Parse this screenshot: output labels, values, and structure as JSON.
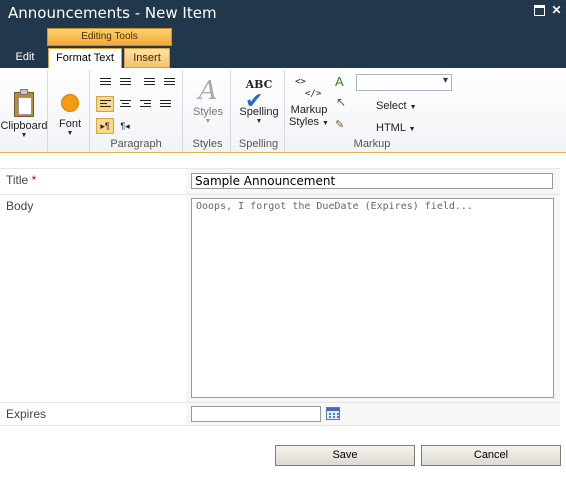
{
  "window": {
    "title": "Announcements - New Item",
    "close_glyph": "✕"
  },
  "ribbon_tabs": {
    "context_group": "Editing Tools",
    "edit": "Edit",
    "format_text": "Format Text",
    "insert": "Insert"
  },
  "ribbon": {
    "clipboard": {
      "button": "Clipboard"
    },
    "font": {
      "button": "Font"
    },
    "paragraph": {
      "label": "Paragraph"
    },
    "styles": {
      "button": "Styles",
      "label": "Styles"
    },
    "spelling": {
      "button": "Spelling",
      "label": "Spelling",
      "glyph": "ABC"
    },
    "markup": {
      "styles_button_line1": "Markup",
      "styles_button_line2": "Styles",
      "select": "Select",
      "html": "HTML",
      "label": "Markup",
      "glyph_top": "<>",
      "glyph_bottom": "</>"
    }
  },
  "form": {
    "title_label": "Title",
    "required_marker": "*",
    "title_value": "Sample Announcement",
    "body_label": "Body",
    "body_value": "Ooops, I forgot the DueDate (Expires) field...",
    "expires_label": "Expires",
    "expires_value": ""
  },
  "buttons": {
    "save": "Save",
    "cancel": "Cancel"
  },
  "colors": {
    "titlebar": "#21374c",
    "context_tab": "#f3a73c",
    "required": "#cc0000"
  }
}
